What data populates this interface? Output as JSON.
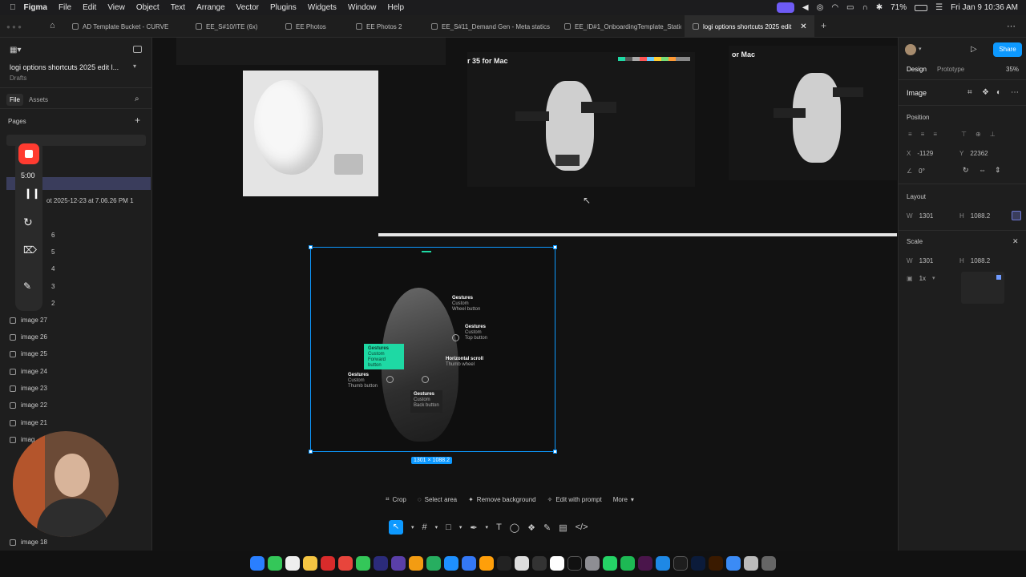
{
  "menubar": {
    "app": "Figma",
    "items": [
      "File",
      "Edit",
      "View",
      "Object",
      "Text",
      "Arrange",
      "Vector",
      "Plugins",
      "Widgets",
      "Window",
      "Help"
    ],
    "battery": "71%",
    "datetime": "Fri Jan 9  10:36 AM"
  },
  "tabs": [
    {
      "label": "AD Template Bucket - CURVE"
    },
    {
      "label": "EE_S#10/ITE (6x)"
    },
    {
      "label": "EE Photos"
    },
    {
      "label": "EE Photos 2"
    },
    {
      "label": "EE_S#11_Demand Gen - Meta statics"
    },
    {
      "label": "EE_ID#1_OnboardingTemplate_Static"
    },
    {
      "label": "logi options shortcuts 2025 edit"
    }
  ],
  "left_panel": {
    "file_title": "logi options shortcuts 2025 edit l...",
    "file_subtitle": "Drafts",
    "tab_file": "File",
    "tab_assets": "Assets",
    "pages_label": "Pages",
    "screenshot_label": "ot 2025-12-23 at 7.06.26 PM 1",
    "partial_layers": [
      "6",
      "5",
      "4",
      "3",
      "2"
    ],
    "layers": [
      "image 27",
      "image 26",
      "image 25",
      "image 24",
      "image 23",
      "image 22",
      "image 21",
      "imag",
      "image 18"
    ]
  },
  "recorder": {
    "time": "5:00"
  },
  "canvas": {
    "frame_label_1": "r 35 for Mac",
    "frame_label_2": "or Mac",
    "selection_size": "1301 × 1088.2",
    "callouts": {
      "c1_title": "Gestures",
      "c1_line1": "Custom",
      "c1_line2": "Wheel button",
      "c2_title": "Gestures",
      "c2_line1": "Custom",
      "c2_line2": "Top button",
      "c3_title": "Gestures",
      "c3_line1": "Custom",
      "c3_line2": "Forward button",
      "c4_title": "Horizontal scroll",
      "c4_line1": "Thumb wheel",
      "c5_title": "Gestures",
      "c5_line1": "Custom",
      "c5_line2": "Thumb button",
      "c6_title": "Gestures",
      "c6_line1": "Custom",
      "c6_line2": "Back button"
    },
    "image_toolbar": {
      "crop": "Crop",
      "select_area": "Select area",
      "remove_background": "Remove background",
      "edit_with_prompt": "Edit with prompt",
      "more": "More"
    }
  },
  "right_panel": {
    "tab_design": "Design",
    "tab_prototype": "Prototype",
    "zoom": "35%",
    "share": "Share",
    "section_image": "Image",
    "position_label": "Position",
    "x_key": "X",
    "x_value": "-1129",
    "y_key": "Y",
    "y_value": "22362",
    "rotation_value": "0°",
    "layout_label": "Layout",
    "w_key": "W",
    "w_value": "1301",
    "h_key": "H",
    "h_value": "1088.2",
    "scale_label": "Scale",
    "scale_w_value": "1301",
    "scale_h_value": "1088.2",
    "scale_factor": "1x"
  },
  "colors": {
    "accent": "#0d99ff",
    "callout_highlight": "#1ed9a4",
    "record_red": "#ff3b30"
  }
}
